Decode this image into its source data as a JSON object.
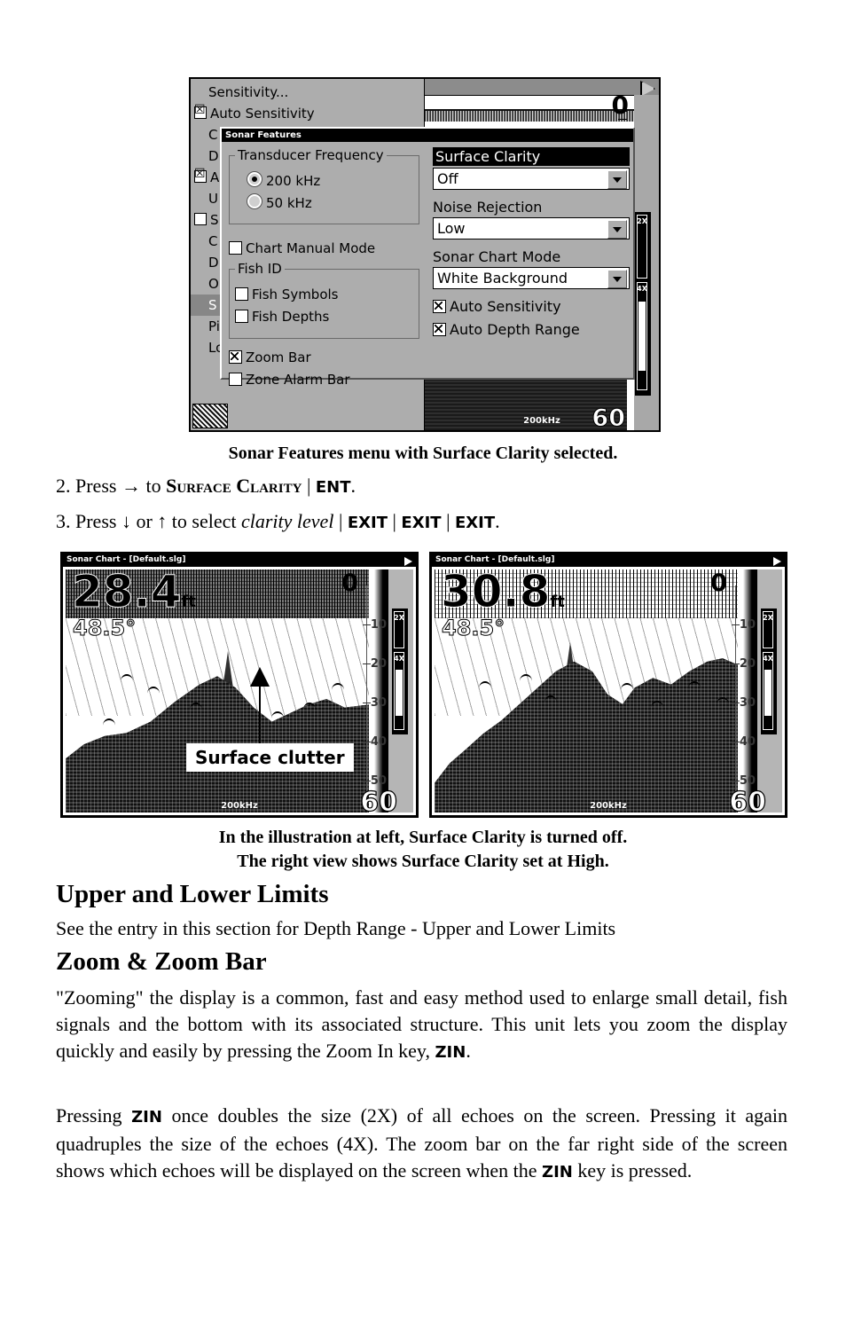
{
  "figure1": {
    "dialog": {
      "title": "Sonar Features",
      "left_column": {
        "transducer_frequency": {
          "legend": "Transducer Frequency",
          "options": [
            {
              "label": "200 kHz",
              "selected": true
            },
            {
              "label": "50 kHz",
              "selected": false
            }
          ]
        },
        "chart_manual_mode": {
          "label": "Chart Manual Mode",
          "checked": false
        },
        "fish_id": {
          "legend": "Fish ID",
          "items": [
            {
              "label": "Fish Symbols",
              "checked": false
            },
            {
              "label": "Fish Depths",
              "checked": false
            }
          ]
        },
        "zoom_bar": {
          "label": "Zoom Bar",
          "checked": true
        },
        "zone_alarm_bar": {
          "label": "Zone Alarm Bar",
          "checked": false
        }
      },
      "right_column": {
        "surface_clarity": {
          "label": "Surface Clarity",
          "value": "Off",
          "highlighted": true
        },
        "noise_rejection": {
          "label": "Noise Rejection",
          "value": "Low"
        },
        "sonar_chart_mode": {
          "label": "Sonar Chart Mode",
          "value": "White Background"
        },
        "auto_sensitivity": {
          "label": "Auto Sensitivity",
          "checked": true
        },
        "auto_depth_range": {
          "label": "Auto Depth Range",
          "checked": true
        }
      }
    },
    "background_menu": {
      "items": [
        {
          "label": "Sensitivity...",
          "checkbox": false,
          "checked": false,
          "selected": false
        },
        {
          "label": "Auto Sensitivity",
          "checkbox": true,
          "checked": true,
          "selected": false
        },
        {
          "label": "C",
          "checkbox": false,
          "checked": false,
          "selected": false
        },
        {
          "label": "D",
          "checkbox": false,
          "checked": false,
          "selected": false
        },
        {
          "label": "A",
          "checkbox": true,
          "checked": true,
          "selected": false
        },
        {
          "label": "U",
          "checkbox": false,
          "checked": false,
          "selected": false
        },
        {
          "label": "S",
          "checkbox": true,
          "checked": false,
          "selected": false
        },
        {
          "label": "C",
          "checkbox": false,
          "checked": false,
          "selected": false
        },
        {
          "label": "D",
          "checkbox": false,
          "checked": false,
          "selected": false
        },
        {
          "label": "O",
          "checkbox": false,
          "checked": false,
          "selected": false
        },
        {
          "label": "S",
          "checkbox": false,
          "checked": false,
          "selected": true
        },
        {
          "label": "Pi",
          "checkbox": false,
          "checked": false,
          "selected": false
        },
        {
          "label": "Lo",
          "checkbox": false,
          "checked": false,
          "selected": false
        }
      ]
    },
    "sonar_background": {
      "zero_label": "0",
      "sixty_label": "60",
      "frequency_label": "200kHz",
      "zoom_bar": {
        "labels": [
          "2X",
          "4X"
        ]
      }
    },
    "caption": "Sonar Features menu with Surface Clarity selected."
  },
  "steps": {
    "step2": {
      "number": "2. ",
      "press": "Press ",
      "arrow": "→",
      "to": " to ",
      "target": "Surface Clarity",
      "sep": " | ",
      "key": "ENT",
      "period": "."
    },
    "step3": {
      "number": "3. ",
      "press": "Press ",
      "down": "↓",
      "or": " or ",
      "up": "↑",
      "to": " to select ",
      "target": "clarity level",
      "sep1": " | ",
      "key1": "EXIT",
      "sep2": " | ",
      "key2": "EXIT",
      "sep3": " | ",
      "key3": "EXIT",
      "period": "."
    }
  },
  "figure2": {
    "left": {
      "titlebar": "Sonar Chart - [Default.slg]",
      "depth": "28.4",
      "units": "ft",
      "temperature": "48.5°",
      "zero_label": "0",
      "sixty_label": "60",
      "frequency_label": "200kHz",
      "callout": "Surface clutter",
      "zoom_bar_labels": [
        "2X",
        "4X"
      ],
      "scale_ticks": [
        "10",
        "20",
        "30",
        "40",
        "50"
      ]
    },
    "right": {
      "titlebar": "Sonar Chart - [Default.slg]",
      "depth": "30.8",
      "units": "ft",
      "temperature": "48.5°",
      "zero_label": "0",
      "sixty_label": "60",
      "frequency_label": "200kHz",
      "zoom_bar_labels": [
        "2X",
        "4X"
      ],
      "scale_ticks": [
        "10",
        "20",
        "30",
        "40",
        "50"
      ]
    },
    "caption_line1": "In the illustration at left, Surface Clarity is turned off.",
    "caption_line2": "The right view shows Surface Clarity set at High."
  },
  "sections": {
    "upper_lower": {
      "heading": "Upper and Lower Limits",
      "body": "See the entry in this section for Depth Range - Upper and Lower Limits"
    },
    "zoom": {
      "heading": "Zoom & Zoom Bar",
      "para1_a": "\"Zooming\" the display is a common, fast and easy method used to enlarge small detail, fish signals and the bottom with its associated structure. This unit lets you zoom the display quickly and easily by pressing the Zoom In key, ",
      "para1_key": "ZIN",
      "para1_b": ".",
      "para2_a": "Pressing ",
      "para2_key1": "ZIN",
      "para2_b": " once doubles the size (2X) of all echoes on the screen. Pressing it again quadruples the size of the echoes (4X). The zoom bar on the far right side of the screen shows which echoes will be displayed on the screen when the ",
      "para2_key2": "ZIN",
      "para2_c": " key is pressed."
    }
  },
  "colors": {
    "dialog_face": "#adadad",
    "titlebar": "#000000",
    "highlight": "#878787",
    "field_bg": "#ffffff"
  }
}
